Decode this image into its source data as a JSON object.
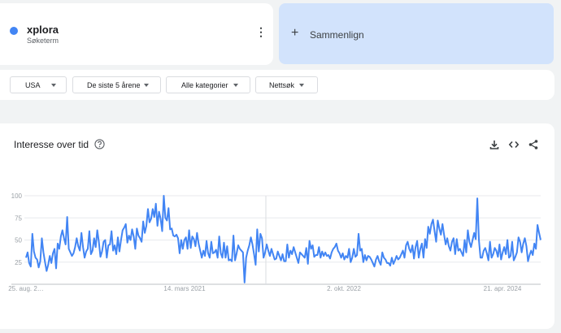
{
  "term": {
    "name": "xplora",
    "subtitle": "Søketerm",
    "color": "#4285f4",
    "more_icon": "more-vert-icon"
  },
  "compare": {
    "label": "Sammenlign",
    "icon": "plus-icon"
  },
  "filters": [
    {
      "label": "USA"
    },
    {
      "label": "De siste 5 årene"
    },
    {
      "label": "Alle kategorier"
    },
    {
      "label": "Nettsøk"
    }
  ],
  "chart_section": {
    "title": "Interesse over tid",
    "help_icon": "help-icon",
    "tools": [
      "download-icon",
      "embed-code-icon",
      "share-icon"
    ]
  },
  "chart_data": {
    "type": "line",
    "ylim": [
      0,
      100
    ],
    "y_ticks": [
      25,
      50,
      75,
      100
    ],
    "x_tick_labels": [
      "25. aug. 2…",
      "14. mars 2021",
      "2. okt. 2022",
      "21. apr. 2024"
    ],
    "grid": true,
    "partial_data_from_index": null,
    "series": [
      {
        "name": "xplora",
        "color": "#4285f4",
        "values": [
          30,
          36,
          24,
          20,
          57,
          37,
          30,
          28,
          19,
          26,
          52,
          36,
          25,
          15,
          22,
          32,
          24,
          35,
          40,
          18,
          46,
          40,
          54,
          61,
          52,
          45,
          76,
          40,
          36,
          32,
          35,
          42,
          52,
          43,
          38,
          58,
          42,
          30,
          37,
          40,
          60,
          34,
          38,
          52,
          42,
          61,
          48,
          31,
          37,
          48,
          50,
          30,
          44,
          45,
          60,
          38,
          44,
          34,
          53,
          37,
          50,
          61,
          64,
          68,
          47,
          55,
          50,
          62,
          54,
          40,
          63,
          55,
          52,
          48,
          71,
          58,
          66,
          85,
          70,
          74,
          85,
          76,
          91,
          66,
          82,
          74,
          60,
          100,
          75,
          72,
          86,
          62,
          63,
          55,
          54,
          56,
          52,
          35,
          50,
          40,
          50,
          53,
          40,
          61,
          41,
          54,
          51,
          43,
          58,
          46,
          38,
          30,
          38,
          32,
          49,
          35,
          30,
          48,
          35,
          36,
          39,
          30,
          54,
          35,
          30,
          47,
          30,
          43,
          27,
          28,
          26,
          55,
          27,
          35,
          44,
          40,
          38,
          36,
          2,
          30,
          38,
          44,
          53,
          45,
          34,
          22,
          62,
          37,
          57,
          52,
          30,
          36,
          45,
          38,
          32,
          40,
          34,
          28,
          29,
          37,
          32,
          27,
          34,
          26,
          26,
          45,
          30,
          38,
          34,
          42,
          36,
          30,
          24,
          36,
          34,
          32,
          30,
          41,
          23,
          49,
          40,
          44,
          31,
          33,
          33,
          42,
          30,
          37,
          32,
          36,
          32,
          33,
          29,
          36,
          40,
          42,
          46,
          38,
          35,
          30,
          35,
          28,
          32,
          30,
          40,
          25,
          30,
          40,
          31,
          33,
          57,
          38,
          40,
          25,
          33,
          27,
          32,
          31,
          28,
          24,
          20,
          28,
          32,
          26,
          22,
          36,
          30,
          28,
          24,
          24,
          21,
          30,
          23,
          27,
          32,
          28,
          30,
          34,
          38,
          30,
          44,
          48,
          40,
          36,
          44,
          29,
          42,
          49,
          30,
          40,
          46,
          30,
          51,
          41,
          65,
          57,
          68,
          73,
          60,
          48,
          72,
          63,
          56,
          68,
          56,
          45,
          52,
          43,
          38,
          48,
          52,
          34,
          51,
          38,
          40,
          36,
          32,
          50,
          36,
          61,
          48,
          42,
          50,
          58,
          51,
          97,
          50,
          30,
          30,
          38,
          41,
          35,
          27,
          48,
          30,
          34,
          41,
          38,
          31,
          45,
          28,
          36,
          42,
          34,
          50,
          30,
          32,
          48,
          27,
          31,
          36,
          53,
          48,
          36,
          46,
          52,
          43,
          26,
          33,
          38,
          33,
          46,
          40,
          67,
          58,
          50
        ]
      }
    ]
  }
}
